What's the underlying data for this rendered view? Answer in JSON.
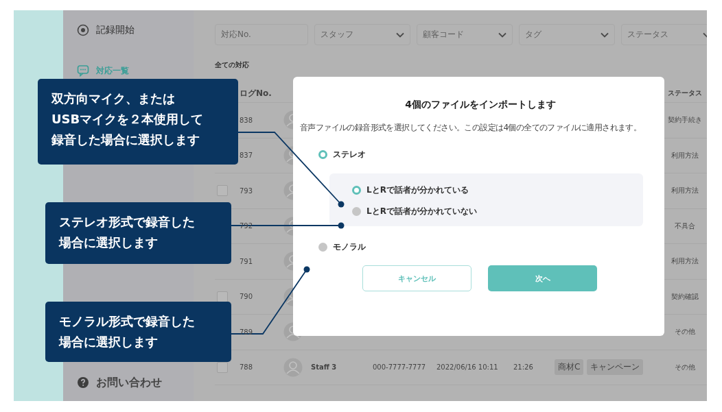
{
  "sidebar": {
    "items": [
      {
        "kind": "eye",
        "label": "記録開始",
        "selected": false
      },
      {
        "kind": "chat",
        "label": "対応一覧",
        "selected": true
      },
      {
        "kind": "help",
        "label": "お問い合わせ",
        "selected": false
      }
    ]
  },
  "filters": [
    {
      "kind": "input",
      "placeholder": "対応No."
    },
    {
      "kind": "select",
      "placeholder": "スタッフ"
    },
    {
      "kind": "select",
      "placeholder": "顧客コード"
    },
    {
      "kind": "select",
      "placeholder": "タグ"
    },
    {
      "kind": "select",
      "placeholder": "ステータス"
    }
  ],
  "list_title": "全ての対応",
  "table": {
    "columns": [
      "ログNo.",
      "ステータス"
    ],
    "rows": [
      {
        "log": "838",
        "status": "契約手続き"
      },
      {
        "log": "837",
        "status": "利用方法"
      },
      {
        "checked": false,
        "log": "793",
        "status": "利用方法"
      },
      {
        "log": "792",
        "status": "不具合"
      },
      {
        "log": "791",
        "status": "利用方法"
      },
      {
        "checked": false,
        "log": "790",
        "status": "契約確認"
      },
      {
        "log": "789",
        "status": "その他"
      },
      {
        "checked": false,
        "log": "788",
        "staff": "Staff 3",
        "phone": "000-7777-7777",
        "date": "2022/06/16 10:11",
        "duration": "21:26",
        "tags": [
          "商材C",
          "キャンペーン"
        ],
        "status": "その他"
      }
    ]
  },
  "dialog": {
    "title": "4個のファイルをインポートします",
    "description": "音声ファイルの録音形式を選択してください。この設定は4個の全てのファイルに適用されます。",
    "options": [
      {
        "label": "ステレオ",
        "selected": true,
        "children": [
          {
            "label": "LとRで話者が分かれている",
            "selected": true
          },
          {
            "label": "LとRで話者が分かれていない",
            "selected": false
          }
        ]
      },
      {
        "label": "モノラル",
        "selected": false
      }
    ],
    "buttons": [
      {
        "kind": "secondary",
        "label": "キャンセル"
      },
      {
        "kind": "primary",
        "label": "次へ"
      }
    ]
  },
  "annotations": [
    {
      "lines": [
        "双方向マイク、または",
        "USBマイクを２本使用して",
        "録音した場合に選択します"
      ]
    },
    {
      "lines": [
        "ステレオ形式で録音した",
        "場合に選択します"
      ]
    },
    {
      "lines": [
        "モノラル形式で録音した",
        "場合に選択します"
      ]
    }
  ]
}
